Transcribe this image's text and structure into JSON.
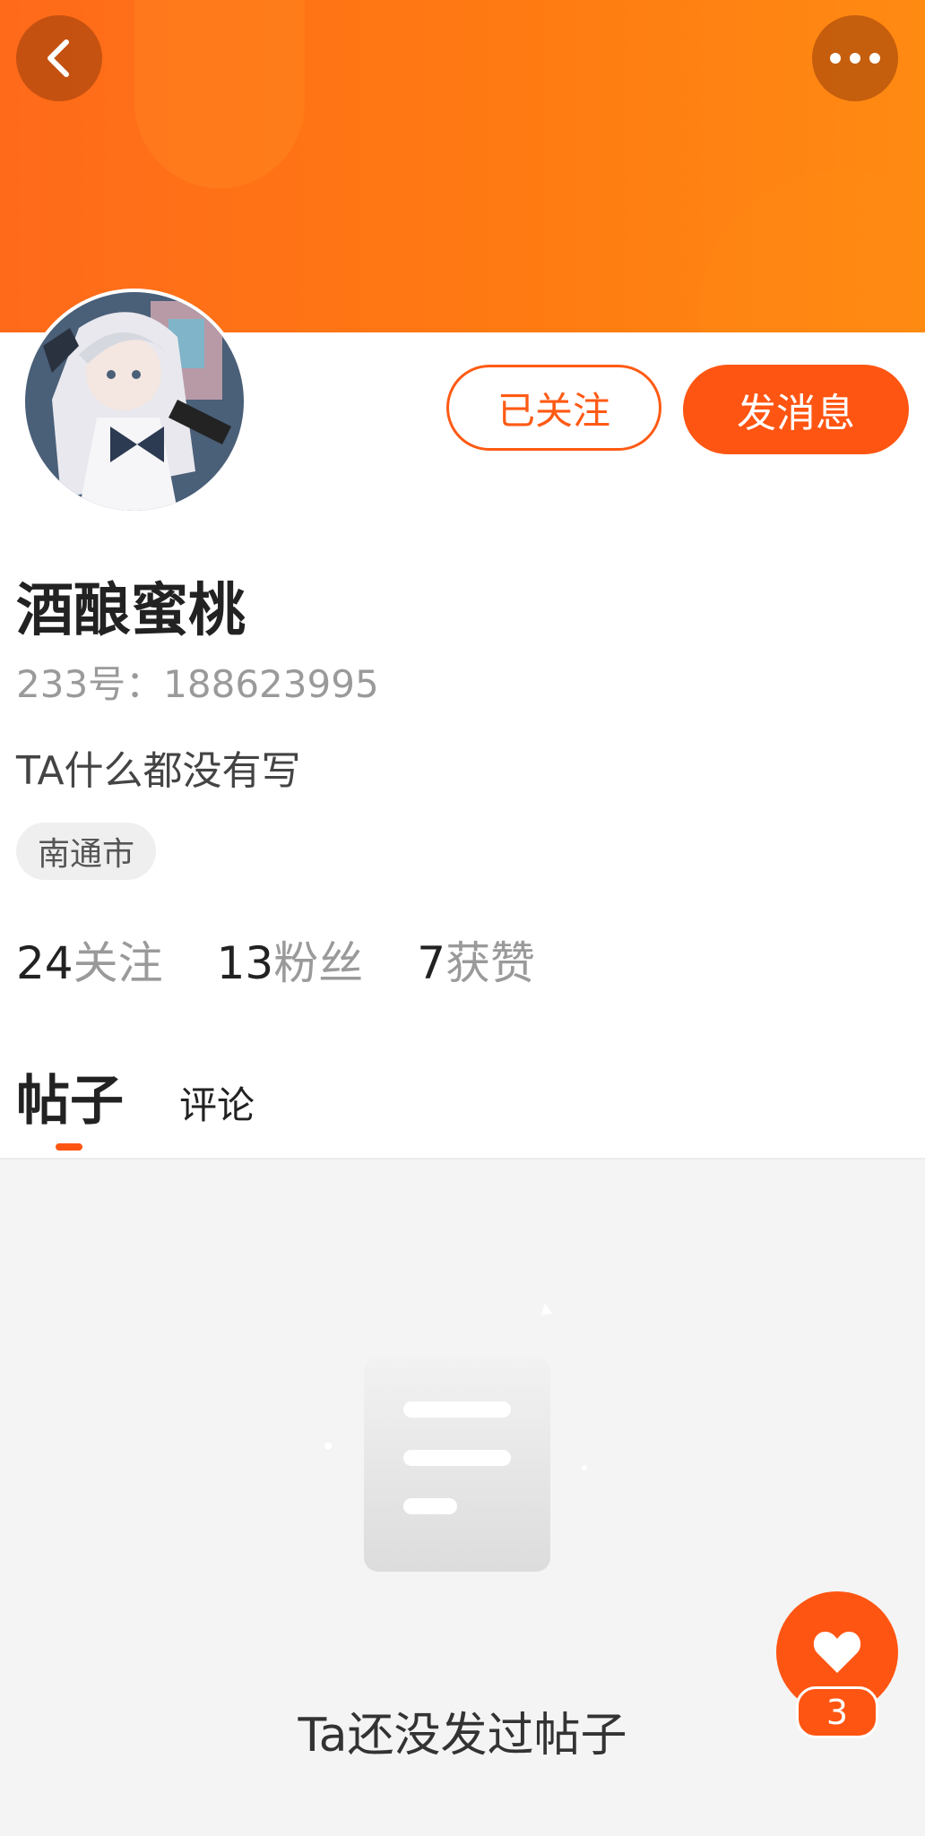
{
  "header": {
    "back_icon": "chevron-left-icon",
    "more_icon": "more-horizontal-icon",
    "banner_color": "#ff6a1a"
  },
  "profile": {
    "avatar_icon": "user-avatar",
    "name": "酒酿蜜桃",
    "id_text": "233号：188623995",
    "bio": "TA什么都没有写",
    "location": "南通市"
  },
  "actions": {
    "follow_label": "已关注",
    "message_label": "发消息"
  },
  "stats": [
    {
      "num": "24",
      "label": "关注"
    },
    {
      "num": "13",
      "label": "粉丝"
    },
    {
      "num": "7",
      "label": "获赞"
    }
  ],
  "tabs": {
    "posts": "帖子",
    "comments": "评论"
  },
  "empty": {
    "icon": "empty-document-icon",
    "message": "Ta还没发过帖子"
  },
  "like": {
    "icon": "heart-icon",
    "count": "3"
  },
  "colors": {
    "accent": "#ff5512",
    "muted": "#9a9a9a",
    "content_bg": "#f4f4f4"
  }
}
